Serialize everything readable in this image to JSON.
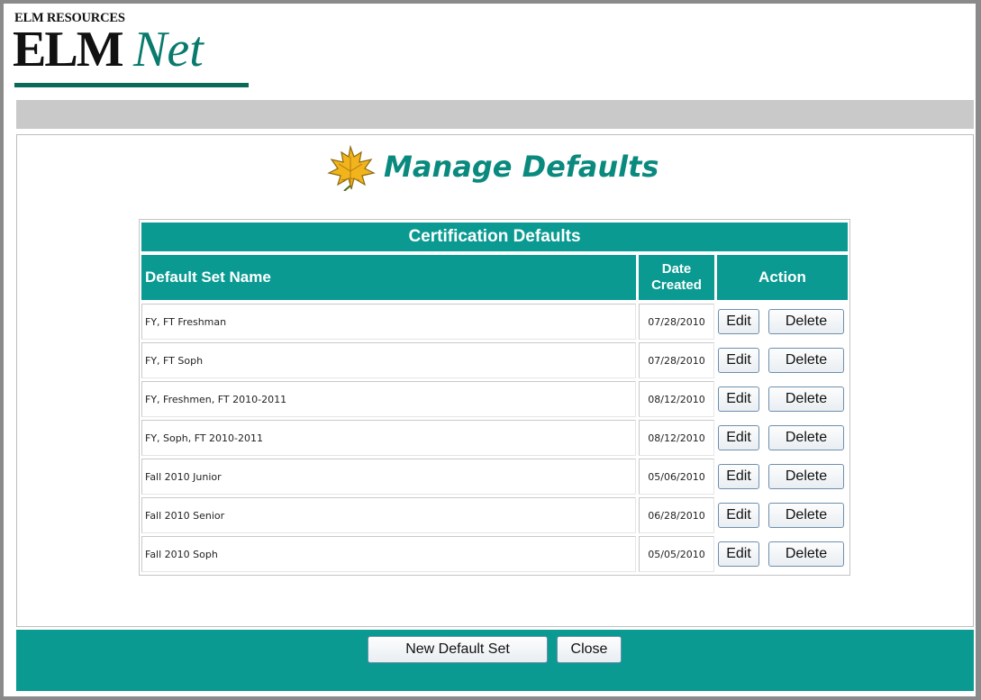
{
  "logo": {
    "top_text": "ELM RESOURCES",
    "main_text": "ELM",
    "accent_text": "Net"
  },
  "page": {
    "title": "Manage Defaults"
  },
  "table": {
    "caption": "Certification Defaults",
    "headers": {
      "name": "Default Set Name",
      "date": "Date Created",
      "action": "Action"
    },
    "rows": [
      {
        "name": "FY, FT Freshman",
        "date": "07/28/2010",
        "edit": "Edit",
        "delete": "Delete"
      },
      {
        "name": "FY, FT Soph",
        "date": "07/28/2010",
        "edit": "Edit",
        "delete": "Delete"
      },
      {
        "name": "FY, Freshmen, FT 2010-2011",
        "date": "08/12/2010",
        "edit": "Edit",
        "delete": "Delete"
      },
      {
        "name": "FY, Soph, FT 2010-2011",
        "date": "08/12/2010",
        "edit": "Edit",
        "delete": "Delete"
      },
      {
        "name": "Fall 2010 Junior",
        "date": "05/06/2010",
        "edit": "Edit",
        "delete": "Delete"
      },
      {
        "name": "Fall 2010 Senior",
        "date": "06/28/2010",
        "edit": "Edit",
        "delete": "Delete"
      },
      {
        "name": "Fall 2010 Soph",
        "date": "05/05/2010",
        "edit": "Edit",
        "delete": "Delete"
      }
    ]
  },
  "footer": {
    "new_label": "New Default Set",
    "close_label": "Close"
  },
  "colors": {
    "teal": "#0a9a92",
    "title_teal": "#0a8a7e",
    "nav_gray": "#c9c9c9"
  },
  "icons": {
    "title_icon": "maple-leaf-icon"
  }
}
